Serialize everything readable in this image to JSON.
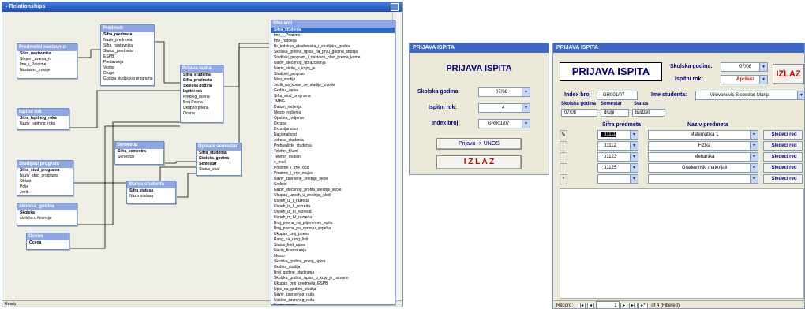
{
  "relationships": {
    "title": "Relationships",
    "status": "Ready",
    "status_right": "NUM",
    "tables": {
      "predmeti": {
        "name": "Predmeti",
        "fields": [
          "Šifra_predmeta",
          "Naziv_predmeta",
          "Šifra_nastavnika",
          "Status_predmeta",
          "ESPB",
          "Predavanja",
          "Vezbe",
          "Drugo",
          "Godina studijskog programa"
        ],
        "key": [
          0
        ]
      },
      "nastavnici": {
        "name": "Predmetni nastavnici",
        "fields": [
          "Šifra_nastavnika",
          "Stepen_zvanja_n",
          "Ime_i_Prezime",
          "Nastavno_zvanje"
        ],
        "key": [
          0
        ]
      },
      "prijava": {
        "name": "Prijava ispita",
        "fields": [
          "Šifra_studenta",
          "Šifra_predmeta",
          "Skolska godina",
          "Ispitni rok",
          "Predlog_ocena",
          "Broj Poena",
          "Ukupno poena",
          "Ocena"
        ],
        "key": [
          0,
          1,
          2,
          3
        ]
      },
      "ispitni": {
        "name": "Ispitni rok",
        "fields": [
          "Šifra_ispitnog_roka",
          "Naziv_ispitnog_roka"
        ],
        "key": [
          0
        ]
      },
      "semestar": {
        "name": "Semestar",
        "fields": [
          "Šifra_semestra",
          "Semestar"
        ],
        "key": [
          0
        ]
      },
      "upisani": {
        "name": "Upisani semestar",
        "fields": [
          "Šifra_studenta",
          "Skolska_godina",
          "Semestar",
          "Status_stud"
        ],
        "key": [
          0,
          1,
          2
        ]
      },
      "studijski": {
        "name": "Studijski program",
        "fields": [
          "Šifra_stud_programa",
          "Naziv_stud_programa",
          "Oblast",
          "Polje",
          "Jezik"
        ],
        "key": [
          0
        ]
      },
      "statusstud": {
        "name": "Status studenta",
        "fields": [
          "Šifra statusa",
          "Naziv statusa"
        ],
        "key": [
          0
        ]
      },
      "skolska": {
        "name": "skolska_godina",
        "fields": [
          "Skolska",
          "skolska u finansije"
        ],
        "key": [
          0
        ]
      },
      "ocene": {
        "name": "Ocene",
        "fields": [
          "Ocena"
        ],
        "key": [
          0
        ]
      },
      "studenti": {
        "name": "Studenti",
        "fields": [
          "Šifra_studenta",
          "Ime_i_Prezime",
          "Ime_roditelja",
          "Br_indeksa_akademska_i_studijska_godina",
          "Skolska_godina_upisa_na_prvu_godinu_studija",
          "Studijski_program_i_nastavni_plan_prema_kome",
          "Naziv_stečenog_obrazovanja",
          "Naziv_skole_u_kojoj_je",
          "Studijski_program",
          "Nivo_studija",
          "Jezik_na_kome_se_studije_izvode",
          "Godina_upisa",
          "Šifra_stud_programa",
          "JMBG",
          "Datum_rodjenja",
          "Mesto_rodjenja",
          "Opstina_rodjenja",
          "Drzava",
          "Drzavljanstvo",
          "Nacionalnost",
          "Adresa_studenta",
          "Prebivaliste_studenta",
          "Telefon_fiksni",
          "Telefon_mobilni",
          "e_mail",
          "Prezime_i_ime_oca",
          "Prezime_i_ime_majke",
          "Naziv_zavrsene_srednje_skole",
          "Sediste",
          "Naziv_stečenog_profila_srednje_skole",
          "Ukupan_uspeh_u_srednjoj_skoli",
          "Uspeh_iz_I_razreda",
          "Uspeh_iz_II_razreda",
          "Uspeh_iz_III_razreda",
          "Uspeh_iz_IV_razreda",
          "Broj_poena_na_prijemnom_ispitu",
          "Broj_poena_po_osnovu_uspeha",
          "Ukupan_broj_poena",
          "Rang_na_rang_listi",
          "Status_kod_upisa",
          "Nacin_finansiranja",
          "Mesto",
          "Skolska_godina_prvog_upisa",
          "Godina_studija",
          "Broj_godine_studiranja",
          "Skolska_godina_upisa_u_koju_je_ostvario",
          "Ukupan_broj_predmeta_ESPB",
          "Upis_na_godinu_studija",
          "Naziv_zavrsenog_rada",
          "Naslov_zavrsnog_rada",
          "Naziv_grupe"
        ],
        "key": [
          0
        ]
      }
    }
  },
  "form_left": {
    "title": "PRIJAVA ISPITA",
    "heading": "PRIJAVA ISPITA",
    "skolska_label": "Skolska godina:",
    "skolska_value": "07/08",
    "rok_label": "Ispitni rok:",
    "rok_value": "4",
    "index_label": "Index broj:",
    "index_value": "GR001/07",
    "btn_prijava": "Prijava -> UNOS",
    "btn_izlaz": "I Z L A Z"
  },
  "form_right": {
    "title": "PRIJAVA ISPITA",
    "heading": "PRIJAVA ISPITA",
    "skolska_label": "Skolska godina:",
    "skolska_value": "07/08",
    "rok_label": "Ispitni rok:",
    "rok_value": "Aprilski",
    "izlaz_label": "IZLAZ",
    "index_label": "Index broj",
    "index_value": "GR001/07",
    "ime_label": "Ime studenta:",
    "ime_value": "Milovanovic Slobodan Marija",
    "sub_headers": [
      "Skolska godina",
      "Semestar",
      "Status"
    ],
    "sub_values": [
      "07/08",
      "drugi",
      "budzet"
    ],
    "col_sifra": "Šifra predmeta",
    "col_naziv": "Naziv predmeta",
    "rows": [
      {
        "sifra": "31111",
        "naziv": "Matematika 1",
        "btn": "Sledeci red"
      },
      {
        "sifra": "31112",
        "naziv": "Fizika",
        "btn": "Sledeci red"
      },
      {
        "sifra": "31123",
        "naziv": "Mehanika",
        "btn": "Sledeci red"
      },
      {
        "sifra": "31125",
        "naziv": "Gradevinski materijali",
        "btn": "Sledeci red"
      },
      {
        "sifra": "",
        "naziv": "",
        "btn": "Sledeci red"
      }
    ],
    "record_label": "Record:",
    "record_current": "1",
    "record_total": "of 4 (Filtered)"
  }
}
